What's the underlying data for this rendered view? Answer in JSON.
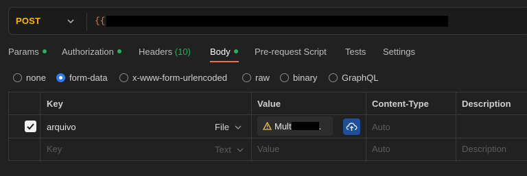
{
  "request": {
    "method": "POST",
    "url_visible": "{{"
  },
  "tabs": [
    {
      "label": "Params",
      "dot": true
    },
    {
      "label": "Authorization",
      "dot": true
    },
    {
      "label": "Headers",
      "count": "(10)"
    },
    {
      "label": "Body",
      "dot": true,
      "active": true
    },
    {
      "label": "Pre-request Script"
    },
    {
      "label": "Tests"
    },
    {
      "label": "Settings"
    }
  ],
  "body_types": [
    {
      "label": "none",
      "selected": false
    },
    {
      "label": "form-data",
      "selected": true
    },
    {
      "label": "x-www-form-urlencoded",
      "selected": false
    },
    {
      "label": "raw",
      "selected": false
    },
    {
      "label": "binary",
      "selected": false
    },
    {
      "label": "GraphQL",
      "selected": false
    }
  ],
  "table": {
    "headers": {
      "key": "Key",
      "value": "Value",
      "content_type": "Content-Type",
      "description": "Description"
    },
    "rows": [
      {
        "checked": true,
        "key": "arquivo",
        "type": "File",
        "value": "Mult",
        "value_suffix": ".",
        "content_type_placeholder": "Auto"
      }
    ],
    "empty_row": {
      "key_placeholder": "Key",
      "type": "Text",
      "value_placeholder": "Value",
      "content_type_placeholder": "Auto",
      "description_placeholder": "Description"
    }
  },
  "colors": {
    "method": "#ffb400",
    "active_tab_underline": "#ff6c37",
    "status_dot": "#26b15a",
    "radio_selected": "#2d7cf6"
  }
}
